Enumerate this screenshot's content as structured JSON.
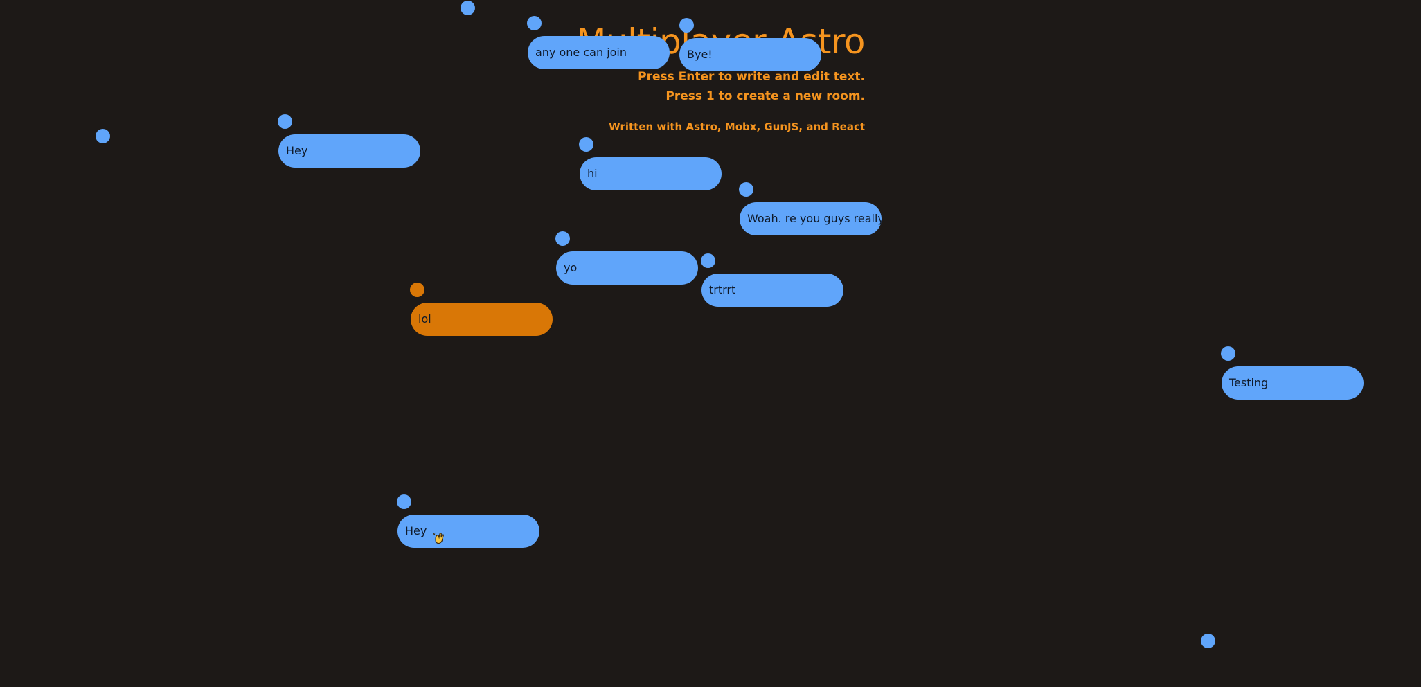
{
  "header": {
    "title": "Multiplayer Astro",
    "instruction_enter": "Press Enter to write and edit text.",
    "instruction_room": "Press 1 to create a new room.",
    "credits": "Written with Astro, Mobx, GunJS, and React"
  },
  "colors": {
    "background": "#1d1917",
    "accent": "#f5941f",
    "remote_user": "#60a5fa",
    "self_user": "#d97706"
  },
  "bubbles": [
    {
      "text": "any one can join",
      "owner": "remote"
    },
    {
      "text": "Bye!",
      "owner": "remote"
    },
    {
      "text": "Hey",
      "owner": "remote"
    },
    {
      "text": "hi",
      "owner": "remote"
    },
    {
      "text": "Woah. re you guys really t",
      "owner": "remote"
    },
    {
      "text": "yo",
      "owner": "remote"
    },
    {
      "text": "trtrrt",
      "owner": "remote"
    },
    {
      "text": "lol",
      "owner": "self"
    },
    {
      "text": "Testing",
      "owner": "remote"
    },
    {
      "text": "Hey",
      "owner": "remote",
      "icon": "waving-hand-icon"
    }
  ]
}
